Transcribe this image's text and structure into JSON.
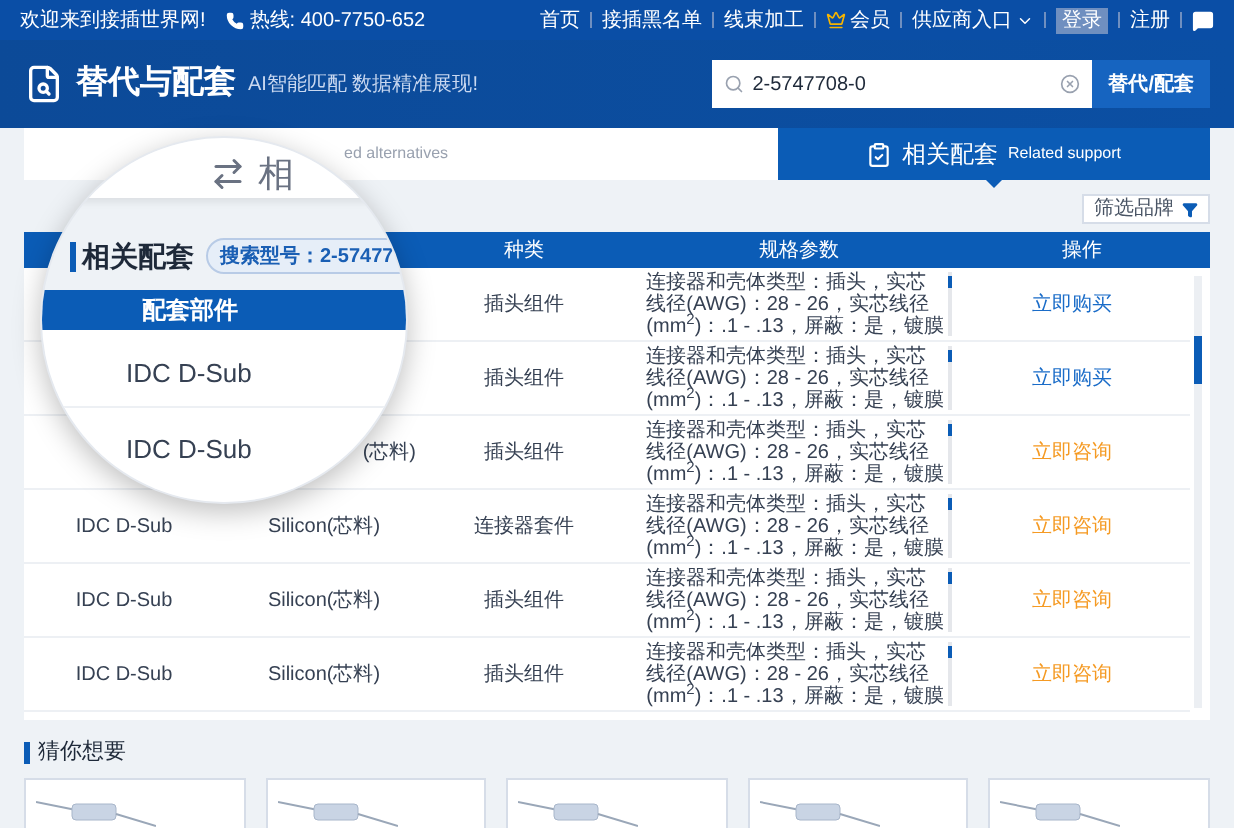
{
  "top_bar": {
    "welcome": "欢迎来到接插世界网!",
    "hotline": "热线: 400-7750-652",
    "links": [
      {
        "label": "首页",
        "kind": "plain"
      },
      {
        "label": "接插黑名单",
        "kind": "plain"
      },
      {
        "label": "线束加工",
        "kind": "plain"
      },
      {
        "label": "会员",
        "kind": "member"
      },
      {
        "label": "供应商入口",
        "kind": "dropdown"
      },
      {
        "label": "登录",
        "kind": "badge"
      },
      {
        "label": "注册",
        "kind": "plain"
      },
      {
        "kind": "chat"
      }
    ]
  },
  "header": {
    "title": "替代与配套",
    "slogan": "AI智能匹配 数据精准展现!",
    "search": {
      "value": "2-5747708-0"
    },
    "search_button": "替代/配套"
  },
  "tabs": [
    {
      "sublabel": "ed alternatives",
      "selected": false
    },
    {
      "label": "相关配套",
      "sublabel": "Related support",
      "selected": true
    }
  ],
  "magnifier": {
    "tab_label": "相",
    "heading": "相关配套",
    "search_badge": "搜索型号：2-57477",
    "column": "配套部件",
    "cells": [
      "IDC D-Sub",
      "IDC D-Sub"
    ]
  },
  "filter_button": "筛选品牌",
  "table": {
    "columns": [
      "种类",
      "规格参数",
      "操作"
    ],
    "rows": [
      {
        "kind": "插头组件",
        "spec": [
          "连接器和壳体类型：插头，实芯",
          "线径(AWG)：28 - 26，实芯线径",
          "(mm$^{2}$)：.1 - .13，屏蔽：是，镀膜"
        ],
        "action": {
          "label": "立即购买",
          "kind": "buy"
        }
      },
      {
        "kind": "插头组件",
        "spec": [
          "连接器和壳体类型：插头，实芯",
          "线径(AWG)：28 - 26，实芯线径",
          "(mm$^{2}$)：.1 - .13，屏蔽：是，镀膜"
        ],
        "action": {
          "label": "立即购买",
          "kind": "buy"
        }
      },
      {
        "material": "(芯料)",
        "kind": "插头组件",
        "spec": [
          "连接器和壳体类型：插头，实芯",
          "线径(AWG)：28 - 26，实芯线径",
          "(mm$^{2}$)：.1 - .13，屏蔽：是，镀膜"
        ],
        "action": {
          "label": "立即咨询",
          "kind": "inquire"
        }
      },
      {
        "part": "IDC D-Sub",
        "material": "Silicon(芯料)",
        "kind": "连接器套件",
        "spec": [
          "连接器和壳体类型：插头，实芯",
          "线径(AWG)：28 - 26，实芯线径",
          "(mm$^{2}$)：.1 - .13，屏蔽：是，镀膜"
        ],
        "action": {
          "label": "立即咨询",
          "kind": "inquire"
        }
      },
      {
        "part": "IDC D-Sub",
        "material": "Silicon(芯料)",
        "kind": "插头组件",
        "spec": [
          "连接器和壳体类型：插头，实芯",
          "线径(AWG)：28 - 26，实芯线径",
          "(mm$^{2}$)：.1 - .13，屏蔽：是，镀膜"
        ],
        "action": {
          "label": "立即咨询",
          "kind": "inquire"
        }
      },
      {
        "part": "IDC D-Sub",
        "material": "Silicon(芯料)",
        "kind": "插头组件",
        "spec": [
          "连接器和壳体类型：插头，实芯",
          "线径(AWG)：28 - 26，实芯线径",
          "(mm$^{2}$)：.1 - .13，屏蔽：是，镀膜"
        ],
        "action": {
          "label": "立即咨询",
          "kind": "inquire"
        }
      }
    ]
  },
  "recommend": {
    "title": "猜你想要",
    "cards": [
      {
        "kind": "cable"
      },
      {
        "kind": "cable"
      },
      {
        "kind": "cable"
      },
      {
        "kind": "cable"
      },
      {
        "kind": "cable"
      }
    ]
  }
}
